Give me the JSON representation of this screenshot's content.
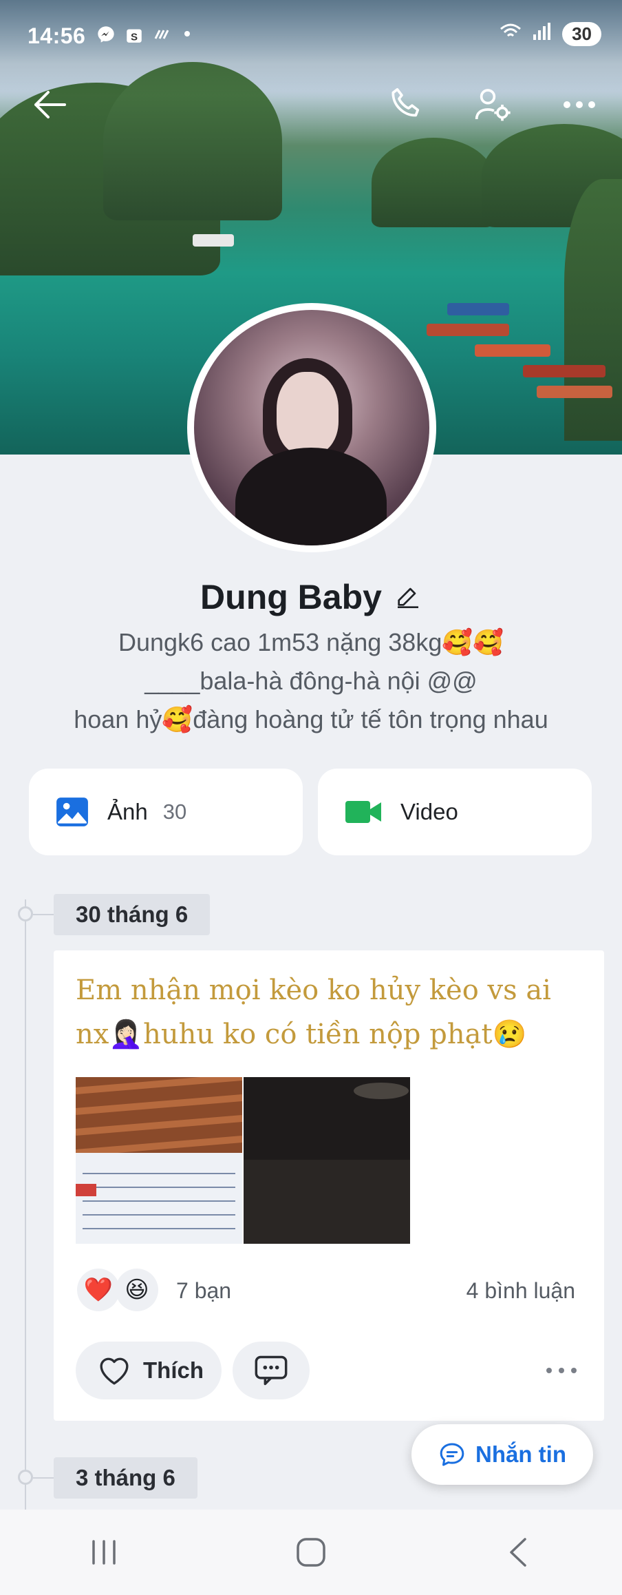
{
  "status_bar": {
    "time": "14:56",
    "battery": "30",
    "icons": [
      "messenger-icon",
      "shopee-icon",
      "signal-slash-icon",
      "dot-icon",
      "wifi-icon",
      "cell-signal-icon"
    ]
  },
  "profile": {
    "name": "Dung Baby",
    "bio_lines": [
      "Dungk6 cao 1m53 nặng 38kg🥰🥰",
      "____bala-hà đông-hà nội @@",
      "hoan hỷ🥰đàng hoàng tử tế tôn trọng nhau"
    ]
  },
  "media": {
    "photos_label": "Ảnh",
    "photos_count": "30",
    "video_label": "Video"
  },
  "timeline": {
    "posts": [
      {
        "date": "30 tháng 6",
        "text": "Em nhận mọi kèo ko hủy kèo vs ai nx🤦🏻‍♀️huhu ko có tiền nộp phạt😢",
        "reactions": [
          "❤️",
          "😆"
        ],
        "reaction_count": "7 bạn",
        "comment_count": "4 bình luận",
        "like_label": "Thích"
      }
    ],
    "next_date": "3 tháng 6"
  },
  "floating": {
    "message_label": "Nhắn tin"
  },
  "colors": {
    "accent_blue": "#1a6fe0",
    "post_text": "#c39a3c",
    "photo_icon": "#1a6fe0",
    "video_icon": "#21b35a"
  }
}
